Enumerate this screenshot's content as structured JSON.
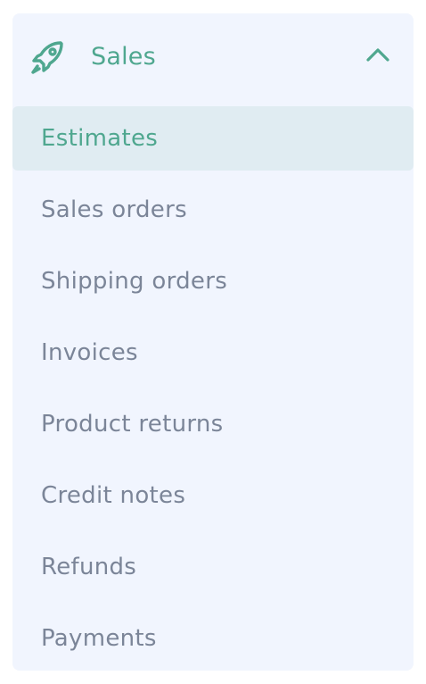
{
  "section": {
    "title": "Sales",
    "icon": "rocket-icon",
    "toggle_icon": "chevron-up-icon",
    "expanded": true
  },
  "colors": {
    "accent": "#4fa78f",
    "panel_bg": "#f1f5fe",
    "active_bg": "#e0ecf2",
    "item_text": "#7b8598"
  },
  "menu": {
    "active_index": 0,
    "items": [
      {
        "label": "Estimates"
      },
      {
        "label": "Sales orders"
      },
      {
        "label": "Shipping orders"
      },
      {
        "label": "Invoices"
      },
      {
        "label": "Product returns"
      },
      {
        "label": "Credit notes"
      },
      {
        "label": "Refunds"
      },
      {
        "label": "Payments"
      }
    ]
  }
}
